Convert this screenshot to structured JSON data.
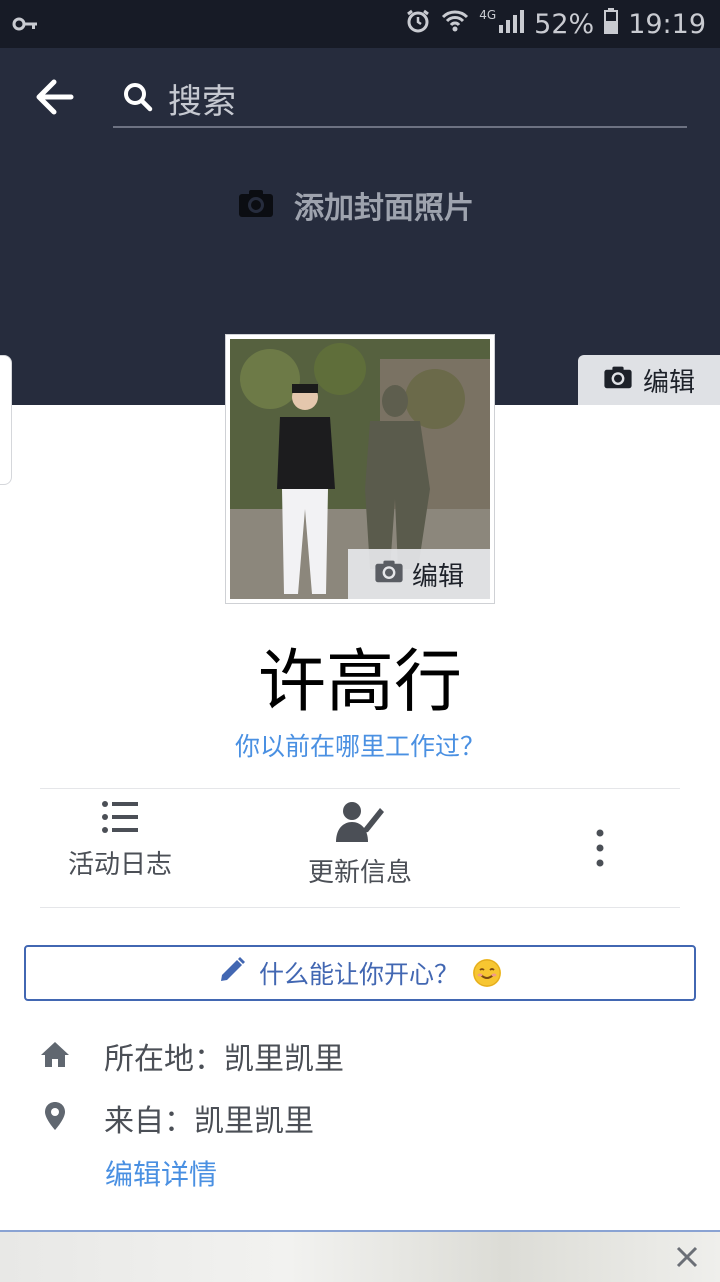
{
  "status_bar": {
    "network": "4G",
    "battery": "52%",
    "time": "19:19"
  },
  "header": {
    "search_placeholder": "搜索"
  },
  "cover": {
    "add_cover_label": "添加封面照片",
    "edit_label": "编辑"
  },
  "profile": {
    "photo_edit_label": "编辑",
    "name": "许高行",
    "work_prompt": "你以前在哪里工作过？"
  },
  "actions": {
    "activity_log": "活动日志",
    "update_info": "更新信息"
  },
  "composer": {
    "prompt": "什么能让你开心？"
  },
  "details": {
    "lives_in": "所在地：凯里凯里",
    "from": "来自：凯里凯里",
    "edit_details": "编辑详情"
  },
  "colors": {
    "cover_bg": "#262c3d",
    "accent_blue": "#4267b2",
    "link_blue": "#4a90e2"
  }
}
